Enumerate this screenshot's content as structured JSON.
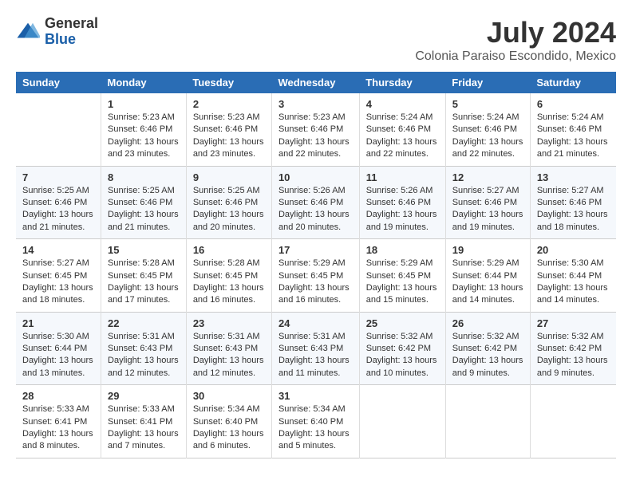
{
  "header": {
    "logo_general": "General",
    "logo_blue": "Blue",
    "title": "July 2024",
    "subtitle": "Colonia Paraiso Escondido, Mexico"
  },
  "days_header": [
    "Sunday",
    "Monday",
    "Tuesday",
    "Wednesday",
    "Thursday",
    "Friday",
    "Saturday"
  ],
  "weeks": [
    [
      {
        "day": "",
        "info": ""
      },
      {
        "day": "1",
        "info": "Sunrise: 5:23 AM\nSunset: 6:46 PM\nDaylight: 13 hours\nand 23 minutes."
      },
      {
        "day": "2",
        "info": "Sunrise: 5:23 AM\nSunset: 6:46 PM\nDaylight: 13 hours\nand 23 minutes."
      },
      {
        "day": "3",
        "info": "Sunrise: 5:23 AM\nSunset: 6:46 PM\nDaylight: 13 hours\nand 22 minutes."
      },
      {
        "day": "4",
        "info": "Sunrise: 5:24 AM\nSunset: 6:46 PM\nDaylight: 13 hours\nand 22 minutes."
      },
      {
        "day": "5",
        "info": "Sunrise: 5:24 AM\nSunset: 6:46 PM\nDaylight: 13 hours\nand 22 minutes."
      },
      {
        "day": "6",
        "info": "Sunrise: 5:24 AM\nSunset: 6:46 PM\nDaylight: 13 hours\nand 21 minutes."
      }
    ],
    [
      {
        "day": "7",
        "info": "Sunrise: 5:25 AM\nSunset: 6:46 PM\nDaylight: 13 hours\nand 21 minutes."
      },
      {
        "day": "8",
        "info": "Sunrise: 5:25 AM\nSunset: 6:46 PM\nDaylight: 13 hours\nand 21 minutes."
      },
      {
        "day": "9",
        "info": "Sunrise: 5:25 AM\nSunset: 6:46 PM\nDaylight: 13 hours\nand 20 minutes."
      },
      {
        "day": "10",
        "info": "Sunrise: 5:26 AM\nSunset: 6:46 PM\nDaylight: 13 hours\nand 20 minutes."
      },
      {
        "day": "11",
        "info": "Sunrise: 5:26 AM\nSunset: 6:46 PM\nDaylight: 13 hours\nand 19 minutes."
      },
      {
        "day": "12",
        "info": "Sunrise: 5:27 AM\nSunset: 6:46 PM\nDaylight: 13 hours\nand 19 minutes."
      },
      {
        "day": "13",
        "info": "Sunrise: 5:27 AM\nSunset: 6:46 PM\nDaylight: 13 hours\nand 18 minutes."
      }
    ],
    [
      {
        "day": "14",
        "info": "Sunrise: 5:27 AM\nSunset: 6:45 PM\nDaylight: 13 hours\nand 18 minutes."
      },
      {
        "day": "15",
        "info": "Sunrise: 5:28 AM\nSunset: 6:45 PM\nDaylight: 13 hours\nand 17 minutes."
      },
      {
        "day": "16",
        "info": "Sunrise: 5:28 AM\nSunset: 6:45 PM\nDaylight: 13 hours\nand 16 minutes."
      },
      {
        "day": "17",
        "info": "Sunrise: 5:29 AM\nSunset: 6:45 PM\nDaylight: 13 hours\nand 16 minutes."
      },
      {
        "day": "18",
        "info": "Sunrise: 5:29 AM\nSunset: 6:45 PM\nDaylight: 13 hours\nand 15 minutes."
      },
      {
        "day": "19",
        "info": "Sunrise: 5:29 AM\nSunset: 6:44 PM\nDaylight: 13 hours\nand 14 minutes."
      },
      {
        "day": "20",
        "info": "Sunrise: 5:30 AM\nSunset: 6:44 PM\nDaylight: 13 hours\nand 14 minutes."
      }
    ],
    [
      {
        "day": "21",
        "info": "Sunrise: 5:30 AM\nSunset: 6:44 PM\nDaylight: 13 hours\nand 13 minutes."
      },
      {
        "day": "22",
        "info": "Sunrise: 5:31 AM\nSunset: 6:43 PM\nDaylight: 13 hours\nand 12 minutes."
      },
      {
        "day": "23",
        "info": "Sunrise: 5:31 AM\nSunset: 6:43 PM\nDaylight: 13 hours\nand 12 minutes."
      },
      {
        "day": "24",
        "info": "Sunrise: 5:31 AM\nSunset: 6:43 PM\nDaylight: 13 hours\nand 11 minutes."
      },
      {
        "day": "25",
        "info": "Sunrise: 5:32 AM\nSunset: 6:42 PM\nDaylight: 13 hours\nand 10 minutes."
      },
      {
        "day": "26",
        "info": "Sunrise: 5:32 AM\nSunset: 6:42 PM\nDaylight: 13 hours\nand 9 minutes."
      },
      {
        "day": "27",
        "info": "Sunrise: 5:32 AM\nSunset: 6:42 PM\nDaylight: 13 hours\nand 9 minutes."
      }
    ],
    [
      {
        "day": "28",
        "info": "Sunrise: 5:33 AM\nSunset: 6:41 PM\nDaylight: 13 hours\nand 8 minutes."
      },
      {
        "day": "29",
        "info": "Sunrise: 5:33 AM\nSunset: 6:41 PM\nDaylight: 13 hours\nand 7 minutes."
      },
      {
        "day": "30",
        "info": "Sunrise: 5:34 AM\nSunset: 6:40 PM\nDaylight: 13 hours\nand 6 minutes."
      },
      {
        "day": "31",
        "info": "Sunrise: 5:34 AM\nSunset: 6:40 PM\nDaylight: 13 hours\nand 5 minutes."
      },
      {
        "day": "",
        "info": ""
      },
      {
        "day": "",
        "info": ""
      },
      {
        "day": "",
        "info": ""
      }
    ]
  ]
}
